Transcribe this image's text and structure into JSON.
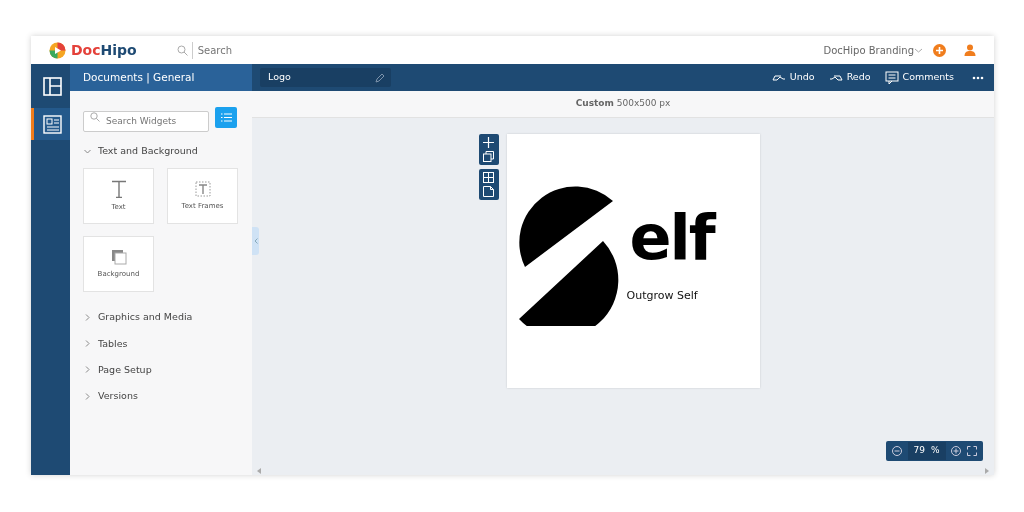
{
  "topbar": {
    "logo": [
      "Doc",
      "Hipo"
    ],
    "search": {
      "placeholder": "Search"
    },
    "workspace": "DocHipo Branding"
  },
  "rail": [
    {
      "kind": "layout",
      "selected": false
    },
    {
      "kind": "widgets",
      "selected": true
    }
  ],
  "panel": {
    "breadcrumb": "Documents | General",
    "search": {
      "placeholder": "Search Widgets"
    },
    "sections": [
      {
        "label": "Text and Background",
        "expanded": true,
        "children": [
          {
            "label": "Text",
            "kind": "text"
          },
          {
            "label": "Text Frames",
            "kind": "frame"
          },
          {
            "label": "Background",
            "kind": "background"
          }
        ]
      },
      {
        "label": "Graphics and Media",
        "expanded": false
      },
      {
        "label": "Tables",
        "expanded": false
      },
      {
        "label": "Page Setup",
        "expanded": false
      },
      {
        "label": "Versions",
        "expanded": false
      }
    ]
  },
  "toolbar": {
    "title": "Logo",
    "actions": [
      {
        "kind": "undo",
        "label": "Undo"
      },
      {
        "kind": "redo",
        "label": "Redo"
      },
      {
        "kind": "comments",
        "label": "Comments"
      }
    ]
  },
  "canvas": {
    "size": "**Custom** 500x500 px",
    "logo_text": "elf",
    "tagline": "Outgrow Self",
    "zoom": "79",
    "zoom_unit": "%"
  }
}
